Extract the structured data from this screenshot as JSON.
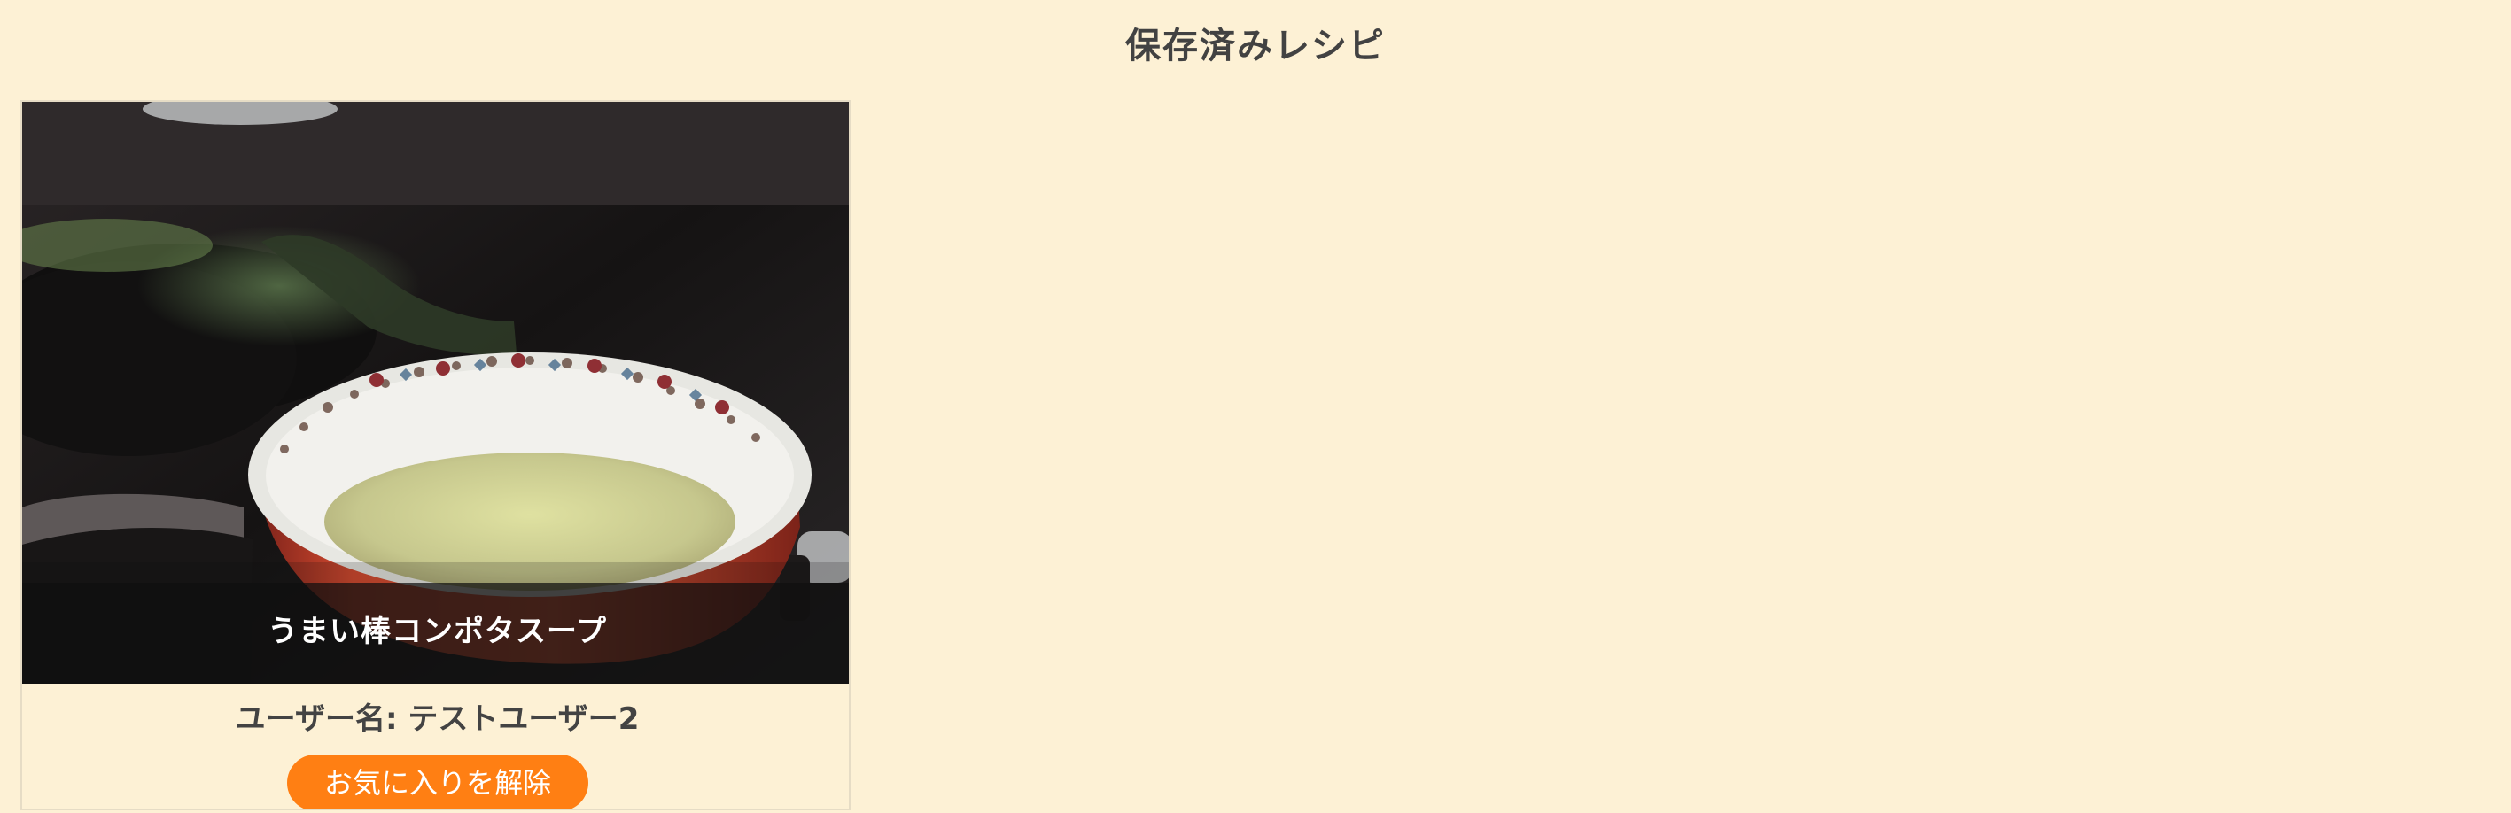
{
  "page": {
    "title": "保存済みレシピ"
  },
  "recipes": [
    {
      "title": "うまい棒コンポタスープ",
      "user_label": "ユーザー名: テストユーザー2",
      "unfavorite_label": "お気に入りを解除",
      "image": "soup-photo"
    }
  ],
  "colors": {
    "background": "#fdf1d5",
    "button": "#ff7f13",
    "text": "#424242",
    "overlay": "#0f0f0f"
  }
}
